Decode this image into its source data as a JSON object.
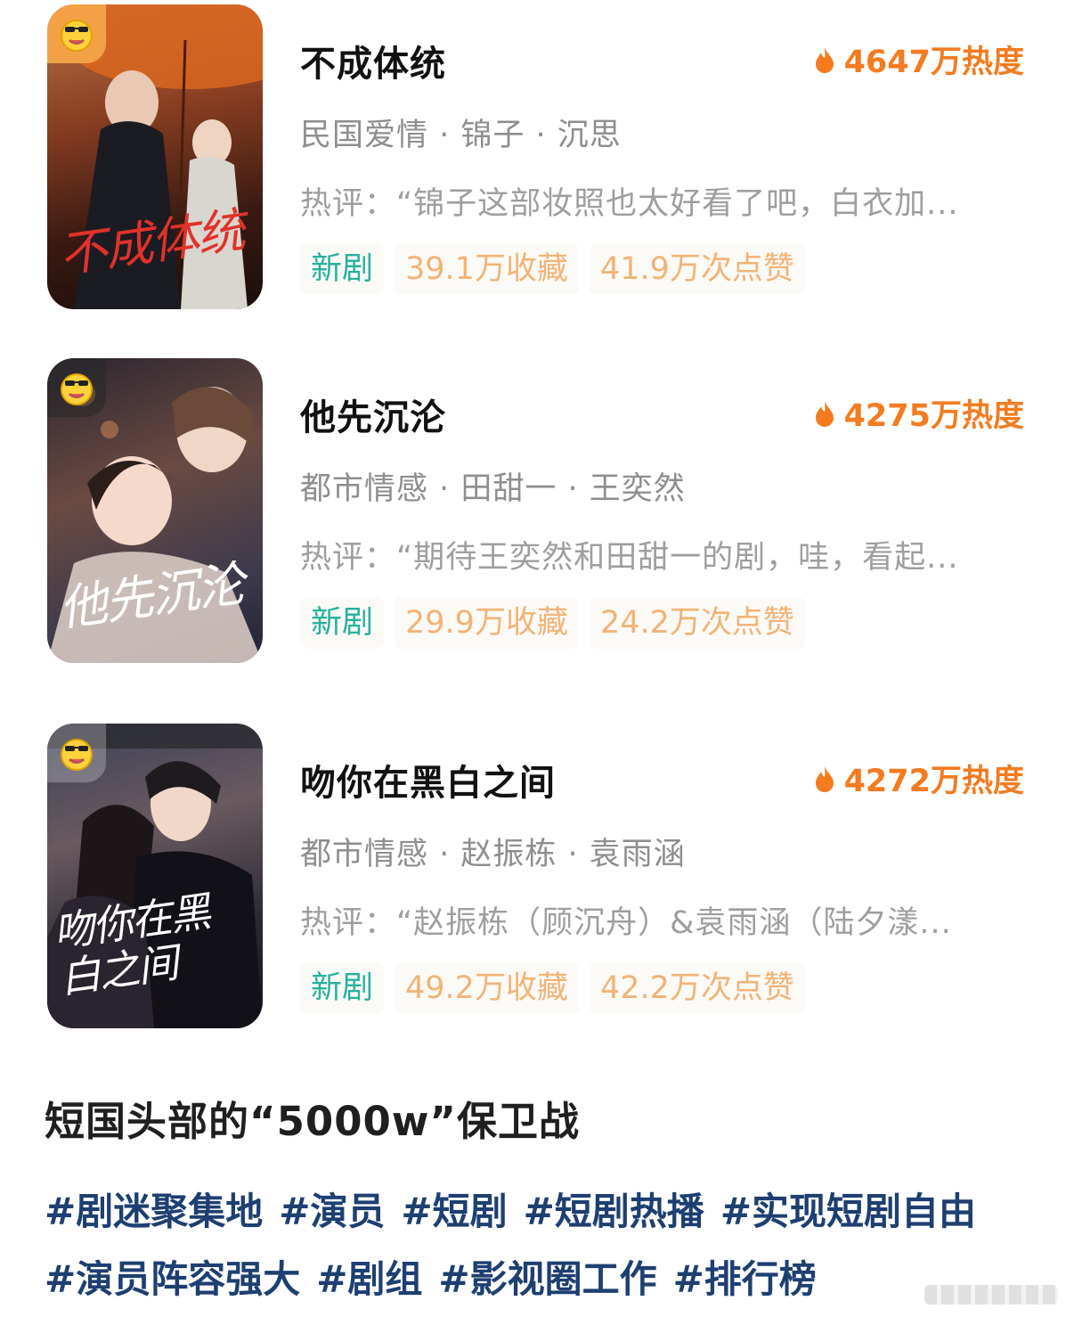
{
  "dramas": [
    {
      "title": "不成体统",
      "heat": "4647万热度",
      "genre": "民国爱情 · 锦子 · 沉思",
      "review": "热评：“锦子这部妆照也太好看了吧，白衣加...",
      "tags": {
        "new": "新剧",
        "favorites": "39.1万收藏",
        "likes": "41.9万次点赞"
      },
      "poster_title": "不成体统"
    },
    {
      "title": "他先沉沦",
      "heat": "4275万热度",
      "genre": "都市情感 · 田甜一 · 王奕然",
      "review": "热评：“期待王奕然和田甜一的剧，哇，看起...",
      "tags": {
        "new": "新剧",
        "favorites": "29.9万收藏",
        "likes": "24.2万次点赞"
      },
      "poster_title": "他先沉沦"
    },
    {
      "title": "吻你在黑白之间",
      "heat": "4272万热度",
      "genre": "都市情感 · 赵振栋 · 袁雨涵",
      "review": "热评：“赵振栋（顾沉舟）&袁雨涵（陆夕漾...",
      "tags": {
        "new": "新剧",
        "favorites": "49.2万收藏",
        "likes": "42.2万次点赞"
      },
      "poster_title": "吻你在黑白之间"
    }
  ],
  "section_title": "短国头部的“5000w”保卫战",
  "hashtags": [
    [
      "#剧迷聚集地",
      "#演员",
      "#短剧",
      "#短剧热播",
      "#实现短剧自由"
    ],
    [
      "#演员阵容强大",
      "#剧组",
      "#影视圈工作",
      "#排行榜"
    ]
  ],
  "colors": {
    "heat": "#f47b1f",
    "tag_new": "#26b19d",
    "tag_stat": "#f3b375",
    "hashtag": "#1e3f71"
  },
  "icons": {
    "heat": "flame-icon",
    "mascot": "sunglasses-face-icon"
  }
}
